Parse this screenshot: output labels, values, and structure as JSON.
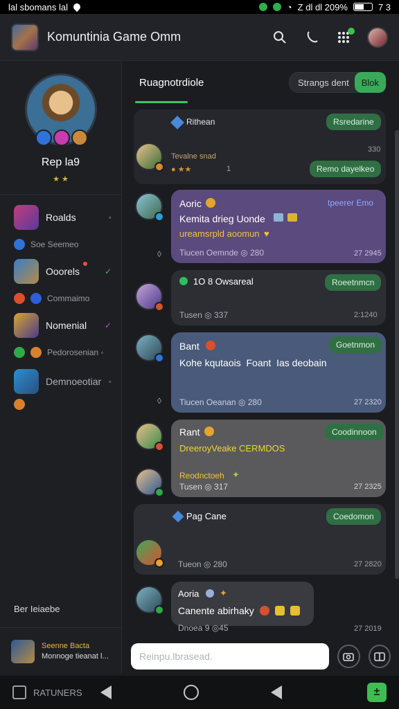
{
  "status_bar": {
    "left_text": "lal sbomans lal",
    "right_text": "Z dl  dl  209%",
    "time": "7 3"
  },
  "app_bar": {
    "title": "Komuntinia Game Omm"
  },
  "profile": {
    "name": "Rep la9",
    "sub": "★ ★"
  },
  "sidebar": {
    "items": [
      {
        "label": "Roalds",
        "meta": "◦",
        "sub": "Soe Seemeo"
      },
      {
        "label": "Ooorels",
        "meta": "✓",
        "sub": "Commaimo"
      },
      {
        "label": "Nomenial",
        "meta": "✓",
        "sub": "Pedorosenian ◦"
      },
      {
        "label": "Demnoeotiar",
        "meta": "◦",
        "sub": ""
      }
    ],
    "footer_label": "Ber Ieiaebe",
    "footer": {
      "line1": "Seenne Bacta",
      "line2": "Monnoge tieanat l..."
    }
  },
  "tabs": {
    "active": "Ruagnotrdiole"
  },
  "filter": {
    "label": "Strangs dent",
    "button": "Blok"
  },
  "feed": [
    {
      "header": "Rithean",
      "pill": "Rsredarine",
      "name": "Tevalne snad",
      "meta": "● ★★",
      "count": "1",
      "time": "330",
      "reply": "Remo dayelkeo"
    },
    {
      "name": "Aoric",
      "tag": "tpeerer Emo",
      "line1": "Kemita drieg Uonde",
      "line2": "ureamsrpld aoomun",
      "footer": "Tiucen Oemnde ◎ 280",
      "time": "27 2945"
    },
    {
      "name": "1O 8 Owsareal",
      "pill": "Roeetnmcn",
      "footer": "Tusen ◎ 337",
      "time": "2:1240"
    },
    {
      "name": "Bant",
      "pill": "Goetnmon",
      "line1": "Kohe kqutaois  Foant  Ias deobain",
      "footer": "Tiucen Oeanan ◎ 280",
      "time": "27 2320"
    },
    {
      "name": "Rant",
      "pill": "Coodinnoon",
      "line1": "DreeroyVeake CERMDOS",
      "line2": "Reodnctoeh",
      "footer": "Tusen ◎ 317",
      "time": "27 2325"
    },
    {
      "name": "Pag Cane",
      "pill": "Coedomon",
      "footer": "Tueon ◎ 280",
      "time": "27 2820"
    },
    {
      "name": "Aoria",
      "line1": "Canente abirhaky",
      "footer": "Dnoea  9 ◎45",
      "time": "27 2019"
    }
  ],
  "composer": {
    "placeholder": "Reinpu.lbrasead."
  },
  "bottom_nav": {
    "label": "RATUNERS"
  },
  "colors": {
    "accent_green": "#3aaa5a",
    "card_purple": "#5b4a7e",
    "card_blue": "#4a5a7a",
    "card_gray": "#5a5a5c",
    "card_dark": "#2c2e34"
  }
}
